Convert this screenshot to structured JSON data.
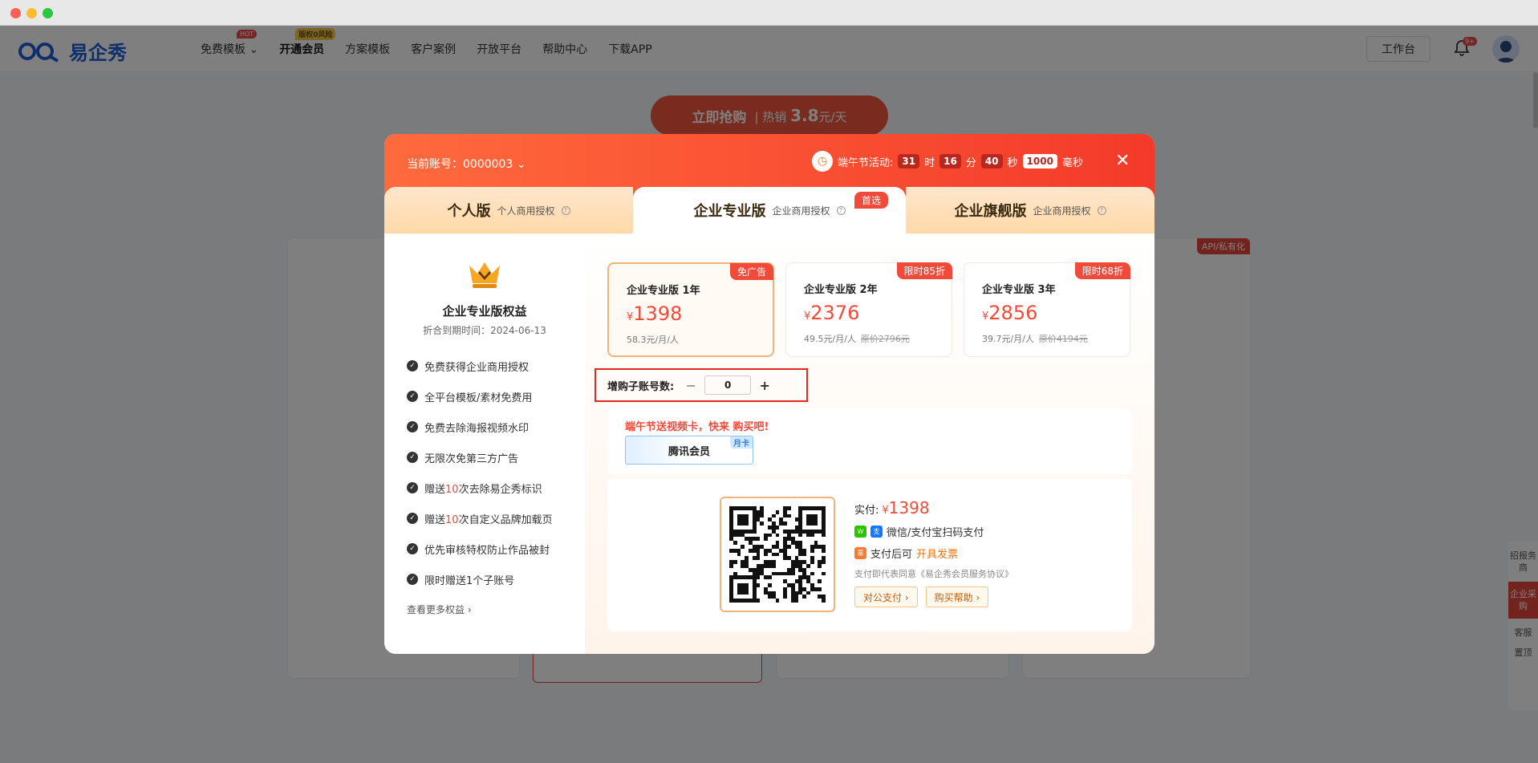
{
  "nav": {
    "logo_text": "易企秀",
    "links": [
      {
        "label": "免费模板",
        "tag": "HOT"
      },
      {
        "label": "开通会员",
        "tag": "版权0风险"
      },
      {
        "label": "方案模板"
      },
      {
        "label": "客户案例"
      },
      {
        "label": "开放平台"
      },
      {
        "label": "帮助中心"
      },
      {
        "label": "下载APP"
      }
    ],
    "workbench": "工作台",
    "bell_badge": "9+"
  },
  "background": {
    "hero_button": "立即抢购",
    "hero_hot": "热销",
    "hero_price": "3.8",
    "hero_unit": "元/天",
    "api_tag": "API/私有化",
    "side_float": [
      "招报务商",
      "企业采购",
      "客服",
      "置顶"
    ]
  },
  "modal": {
    "account_label": "当前账号：",
    "account_value": "0000003",
    "promo_label": "端午节活动:",
    "timer": {
      "h": "31",
      "h_unit": "时",
      "m": "16",
      "m_unit": "分",
      "s": "40",
      "s_unit": "秒",
      "ms": "1000",
      "ms_unit": "毫秒"
    },
    "tabs": [
      {
        "title": "个人版",
        "sub": "个人商用授权"
      },
      {
        "title": "企业专业版",
        "sub": "企业商用授权"
      },
      {
        "title": "企业旗舰版",
        "sub": "企业商用授权"
      }
    ],
    "first_badge": "首选",
    "left": {
      "title": "企业专业版权益",
      "subtitle": "折合到期时间：2024-06-13",
      "benefits": [
        {
          "pre": "免费获得企业商用授权",
          "hl": "",
          "post": ""
        },
        {
          "pre": "全平台模板/素材免费用",
          "hl": "",
          "post": ""
        },
        {
          "pre": "免费去除海报视频水印",
          "hl": "",
          "post": ""
        },
        {
          "pre": "无限次免第三方广告",
          "hl": "",
          "post": ""
        },
        {
          "pre": "赠送",
          "hl": "10",
          "post": "次去除易企秀标识"
        },
        {
          "pre": "赠送",
          "hl": "10",
          "post": "次自定义品牌加载页"
        },
        {
          "pre": "优先审核特权防止作品被封",
          "hl": "",
          "post": ""
        },
        {
          "pre": "限时赠送1个子账号",
          "hl": "",
          "post": ""
        }
      ],
      "more": "查看更多权益 ›"
    },
    "plans": [
      {
        "name": "企业专业版 1年",
        "currency": "¥",
        "price": "1398",
        "per": "58.3元/月/人",
        "orig": "",
        "badge": "免广告"
      },
      {
        "name": "企业专业版 2年",
        "currency": "¥",
        "price": "2376",
        "per": "49.5元/月/人",
        "orig": "原价2796元",
        "badge": "限时85折"
      },
      {
        "name": "企业专业版 3年",
        "currency": "¥",
        "price": "2856",
        "per": "39.7元/月/人",
        "orig": "原价4194元",
        "badge": "限时68折"
      }
    ],
    "sub_accounts": {
      "label": "增购子账号数:",
      "minus": "−",
      "value": "0",
      "plus": "+"
    },
    "gift": {
      "title": "端午节送视频卡，快来 购买吧!",
      "card": "腾讯会员",
      "month": "月卡"
    },
    "pay": {
      "paid_label": "实付:",
      "currency": "¥",
      "amount": "1398",
      "method": "微信/支付宝扫码支付",
      "invoice_pre": "支付后可",
      "invoice_link": "开具发票",
      "agree": "支付即代表同意《易企秀会员服务协议》",
      "btn1": "对公支付 ›",
      "btn2": "购买帮助 ›"
    }
  }
}
